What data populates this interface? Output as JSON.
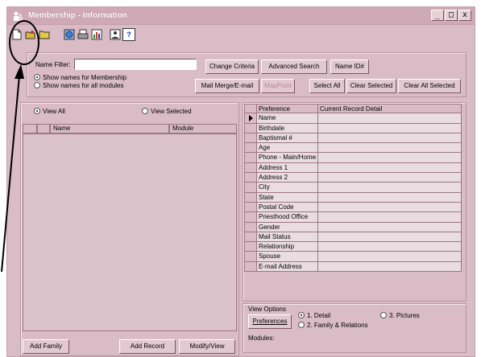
{
  "window": {
    "title": "Membership - Information",
    "minimize_label": "_",
    "maximize_label": "□",
    "close_label": "x"
  },
  "toolbar": {
    "help_label": "?"
  },
  "filter": {
    "name_filter_label": "Name Filter:",
    "name_filter_value": "",
    "radio_membership": "Show names for Membership",
    "radio_all_modules": "Show names for all modules"
  },
  "buttons": {
    "change_criteria": "Change Criteria",
    "advanced_search": "Advanced Search",
    "name_id": "Name ID#",
    "mail_merge": "Mail Merge/E-mail",
    "mappoint": "MapPoint",
    "select_all": "Select All",
    "clear_selected": "Clear Selected",
    "clear_all_selected": "Clear All Selected",
    "add_family": "Add Family",
    "add_record": "Add Record",
    "modify_view": "Modify/View",
    "preferences": "Preferences"
  },
  "view": {
    "view_all": "View All",
    "view_selected": "View Selected"
  },
  "names_grid": {
    "columns": [
      "Name",
      "Module"
    ]
  },
  "preferences_grid": {
    "columns": [
      "Preference",
      "Current Record Detail"
    ],
    "rows": [
      "Name",
      "Birthdate",
      "Baptismal #",
      "Age",
      "Phone - Main/Home",
      "Address 1",
      "Address 2",
      "City",
      "State",
      "Postal Code",
      "Priesthood Office",
      "Gender",
      "Mail Status",
      "Relationship",
      "Spouse",
      "E-mail Address"
    ]
  },
  "view_options": {
    "title": "View Options",
    "detail": "1. Detail",
    "family": "2. Family & Relations",
    "pictures": "3. Pictures",
    "modules_label": "Modules:"
  }
}
